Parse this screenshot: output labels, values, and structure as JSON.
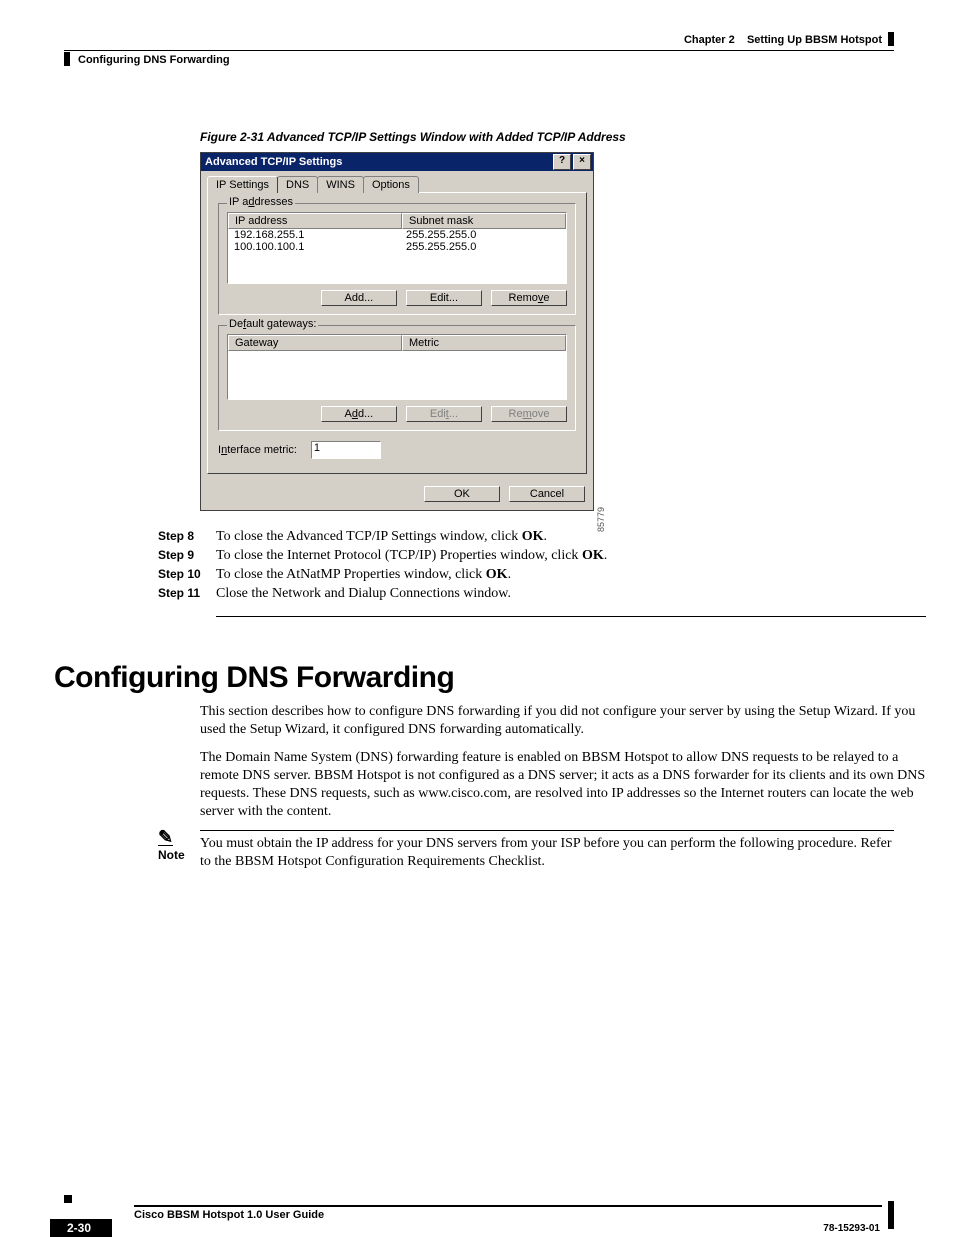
{
  "header": {
    "chapter_label": "Chapter 2",
    "chapter_title": "Setting Up BBSM Hotspot",
    "section_running": "Configuring DNS Forwarding"
  },
  "figure": {
    "caption": "Figure 2-31   Advanced TCP/IP Settings Window with Added TCP/IP Address",
    "image_id": "85779"
  },
  "dialog": {
    "title": "Advanced TCP/IP Settings",
    "help_btn": "?",
    "close_btn": "×",
    "tabs": [
      "IP Settings",
      "DNS",
      "WINS",
      "Options"
    ],
    "ip_group_legend": "IP addresses",
    "ip_headers": {
      "col1": "IP address",
      "col2": "Subnet mask"
    },
    "ip_rows": [
      {
        "ip": "192.168.255.1",
        "mask": "255.255.255.0"
      },
      {
        "ip": "100.100.100.1",
        "mask": "255.255.255.0"
      }
    ],
    "gw_group_legend": "Default gateways:",
    "gw_headers": {
      "col1": "Gateway",
      "col2": "Metric"
    },
    "buttons": {
      "add": "Add...",
      "edit": "Edit...",
      "remove": "Remove"
    },
    "metric_label": "Interface metric:",
    "metric_value": "1",
    "ok": "OK",
    "cancel": "Cancel"
  },
  "steps": [
    {
      "label": "Step 8",
      "text_pre": "To close the Advanced TCP/IP Settings window, click ",
      "bold": "OK",
      "text_post": "."
    },
    {
      "label": "Step 9",
      "text_pre": "To close the Internet Protocol (TCP/IP) Properties window, click ",
      "bold": "OK",
      "text_post": "."
    },
    {
      "label": "Step 10",
      "text_pre": "To close the AtNatMP Properties window, click ",
      "bold": "OK",
      "text_post": "."
    },
    {
      "label": "Step 11",
      "text_pre": "Close the Network and Dialup Connections window.",
      "bold": "",
      "text_post": ""
    }
  ],
  "section": {
    "heading": "Configuring DNS Forwarding",
    "para1": "This section describes how to configure DNS forwarding if you did not configure your server by using the Setup Wizard. If you used the Setup Wizard, it configured DNS forwarding automatically.",
    "para2": "The Domain Name System (DNS) forwarding feature is enabled on BBSM Hotspot to allow DNS requests to be relayed to a remote DNS server. BBSM Hotspot is not configured as a DNS server; it acts as a DNS forwarder for its clients and its own DNS requests. These DNS requests, such as www.cisco.com, are resolved into IP addresses so the Internet routers can locate the web server with the content."
  },
  "note": {
    "label": "Note",
    "text": "You must obtain the IP address for your DNS servers from your ISP before you can perform the following procedure. Refer to the BBSM Hotspot Configuration Requirements Checklist."
  },
  "footer": {
    "title": "Cisco BBSM Hotspot 1.0 User Guide",
    "docnum": "78-15293-01",
    "page": "2-30"
  }
}
